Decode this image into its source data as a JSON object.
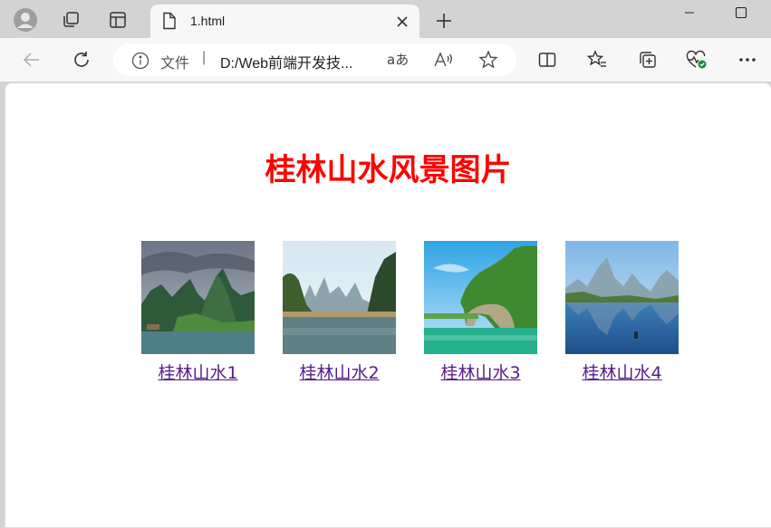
{
  "browser": {
    "tab": {
      "title": "1.html"
    },
    "address": {
      "scheme_label": "文件",
      "separator": "|",
      "url": "D:/Web前端开发技..."
    }
  },
  "page": {
    "heading": "桂林山水风景图片",
    "gallery": [
      {
        "caption": "桂林山水1",
        "image": "guilin-karst-peaks-river-photo"
      },
      {
        "caption": "桂林山水2",
        "image": "guilin-river-bamboo-shore-photo"
      },
      {
        "caption": "桂林山水3",
        "image": "elephant-trunk-hill-photo"
      },
      {
        "caption": "桂林山水4",
        "image": "li-river-reflection-photo"
      }
    ]
  },
  "colors": {
    "heading": "#ff0000",
    "visited_link": "#551a8b",
    "chrome": "#d3d3d3",
    "toolbar": "#f7f7f7"
  }
}
